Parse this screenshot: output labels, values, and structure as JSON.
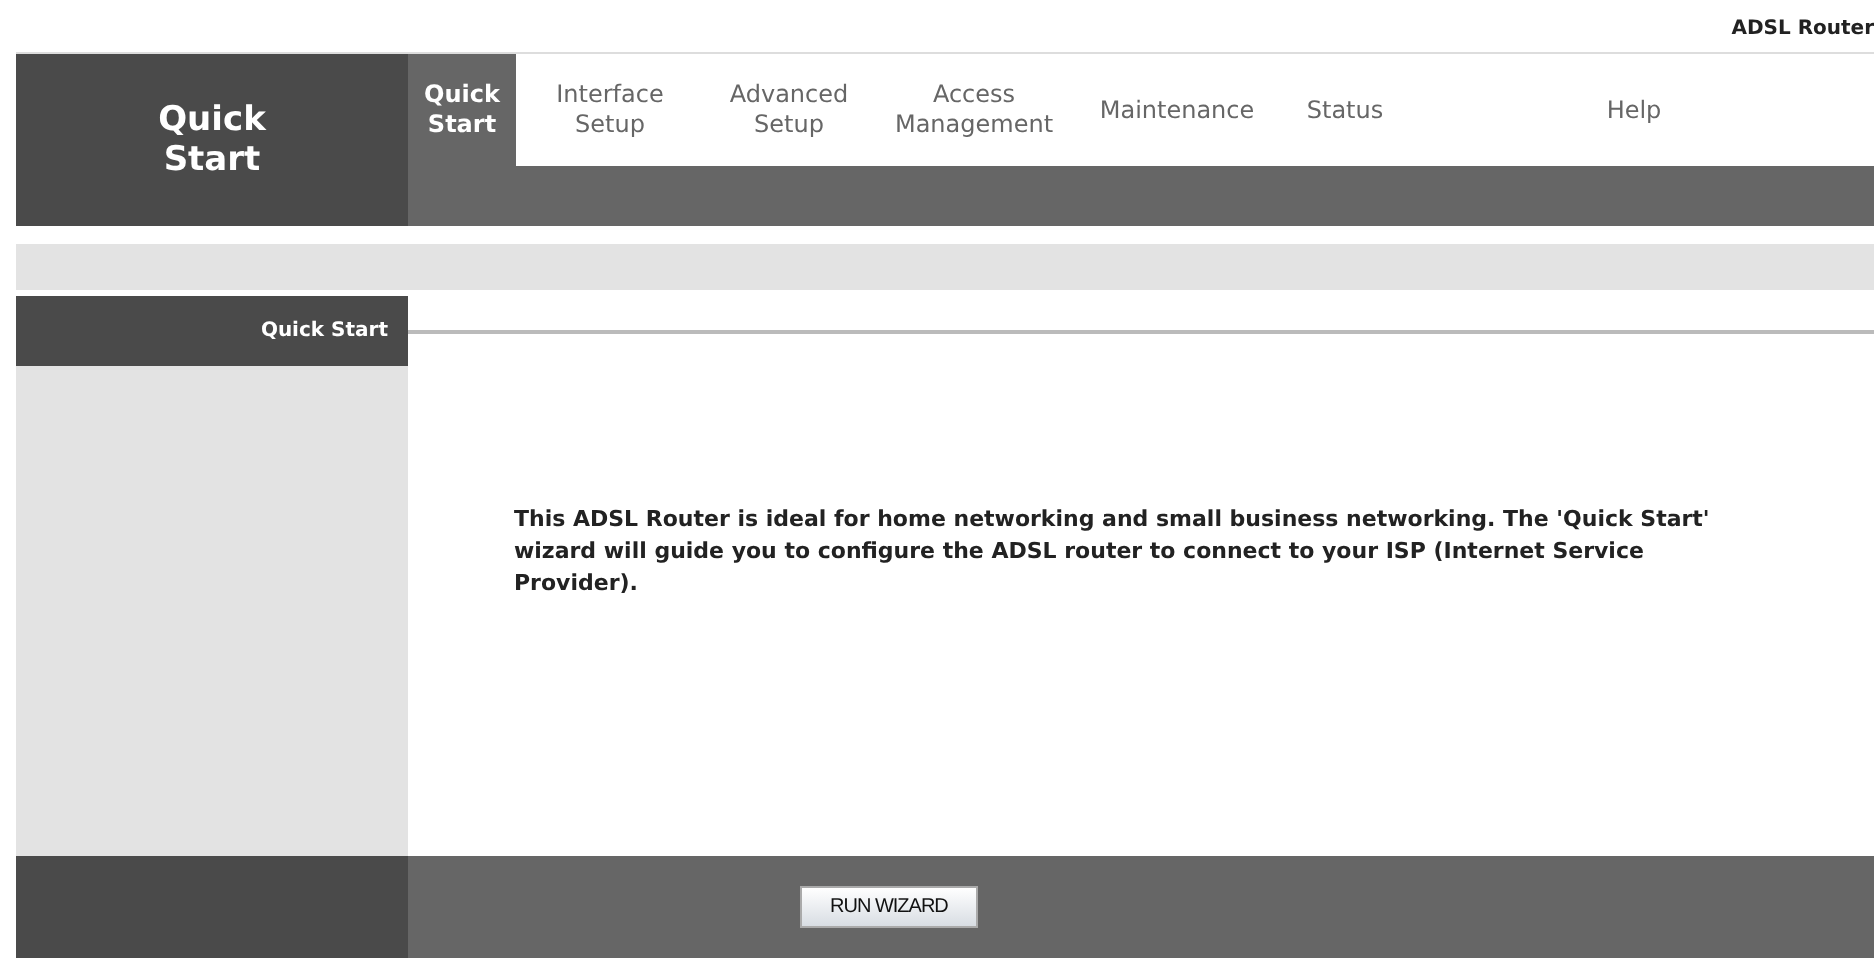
{
  "brand": "ADSL Router",
  "page_title": "Quick Start",
  "tabs": [
    {
      "label": "Quick Start",
      "selected": true
    },
    {
      "label": "Interface Setup",
      "selected": false
    },
    {
      "label": "Advanced Setup",
      "selected": false
    },
    {
      "label": "Access Management",
      "selected": false
    },
    {
      "label": "Maintenance",
      "selected": false
    },
    {
      "label": "Status",
      "selected": false
    },
    {
      "label": "Help",
      "selected": false
    }
  ],
  "section_label": "Quick Start",
  "description": "This ADSL Router is ideal for home networking and small business networking. The 'Quick Start' wizard will guide you to configure the ADSL router to connect to your ISP (Internet Service Provider).",
  "button": "RUN WIZARD"
}
